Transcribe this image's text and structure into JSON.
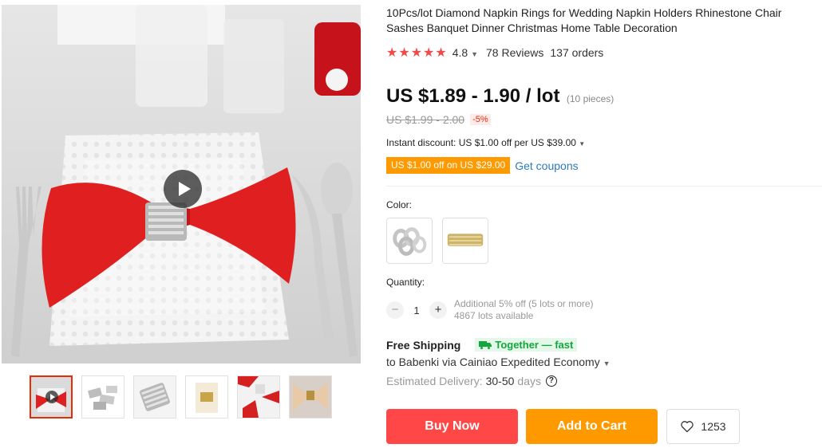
{
  "gallery": {
    "main_image_alt": "napkin-ring-on-red-napkin",
    "thumbnails": [
      {
        "name": "thumb-video-red-napkin",
        "active": true,
        "has_video": true
      },
      {
        "name": "thumb-silver-rings-pile",
        "active": false,
        "has_video": false
      },
      {
        "name": "thumb-silver-ring-closeup",
        "active": false,
        "has_video": false
      },
      {
        "name": "thumb-gold-ring-napkin",
        "active": false,
        "has_video": false
      },
      {
        "name": "thumb-table-setting-red",
        "active": false,
        "has_video": false
      },
      {
        "name": "thumb-gold-ring-beige-napkin",
        "active": false,
        "has_video": false
      }
    ]
  },
  "product": {
    "title": "10Pcs/lot Diamond Napkin Rings for Wedding Napkin Holders Rhinestone Chair Sashes Banquet Dinner Christmas Home Table Decoration",
    "stars": "★★★★★",
    "rating": "4.8",
    "reviews": "78 Reviews",
    "orders": "137 orders",
    "price": "US $1.89 - 1.90 / lot",
    "pieces": "(10 pieces)",
    "original_price": "US $1.99 - 2.00",
    "discount": "-5%",
    "instant_discount": "Instant discount: US $1.00 off per US $39.00",
    "coupon_tag": "US $1.00 off on US $29.00",
    "get_coupons": "Get coupons"
  },
  "options": {
    "color_label": "Color:",
    "colors": [
      "silver",
      "gold"
    ],
    "quantity_label": "Quantity:",
    "quantity": "1",
    "minus": "−",
    "plus": "+",
    "quantity_note_1": "Additional 5% off (5 lots or more)",
    "quantity_note_2": "4867 lots available"
  },
  "shipping": {
    "free_shipping": "Free Shipping",
    "together_badge": "Together — fast",
    "ship_to": "to Babenki via Cainiao Expedited Economy",
    "delivery_label": "Estimated Delivery:",
    "delivery_days": "30-50",
    "delivery_unit": "days",
    "help": "?"
  },
  "actions": {
    "buy_now": "Buy Now",
    "add_to_cart": "Add to Cart",
    "wishlist_count": "1253"
  },
  "colors": {
    "accent_red": "#ff4747",
    "accent_orange": "#ff9900",
    "star_red": "#f14a4a",
    "coupon_orange": "#fe9a00",
    "link_blue": "#2b7bbd",
    "green_badge": "#14a63c"
  }
}
